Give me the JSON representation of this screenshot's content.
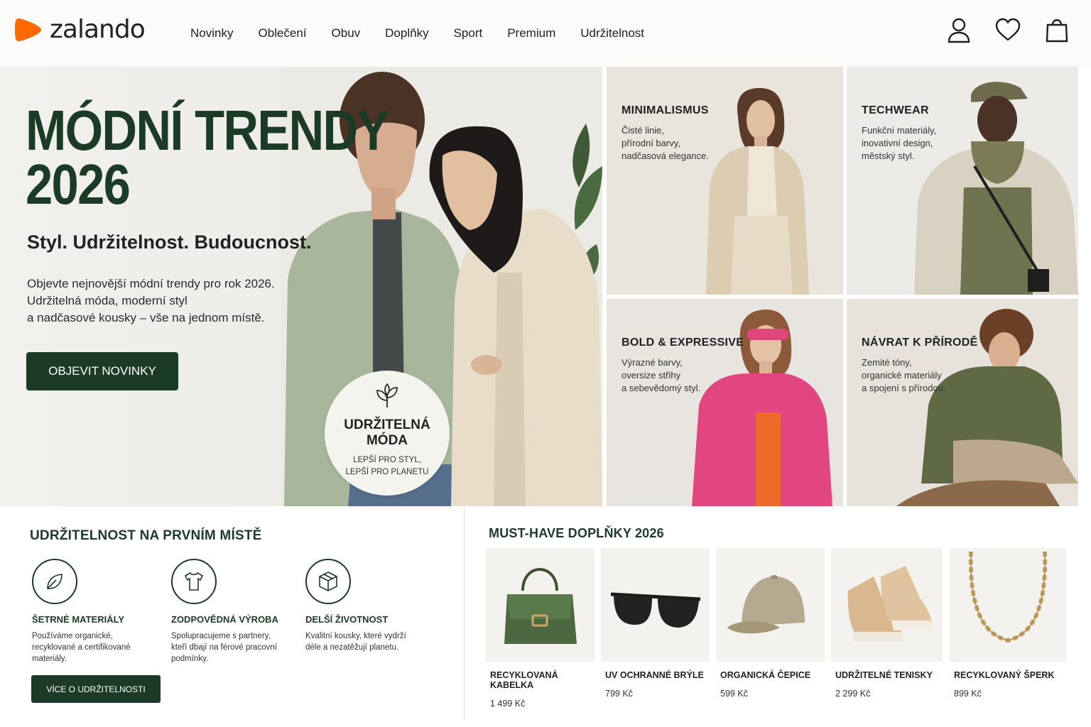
{
  "header": {
    "logo_text": "zalando",
    "brand_color": "#FF6900",
    "nav": [
      "Novinky",
      "Oblečení",
      "Obuv",
      "Doplňky",
      "Sport",
      "Premium",
      "Udržitelnost"
    ],
    "icons": [
      "user-icon",
      "heart-icon",
      "bag-icon"
    ]
  },
  "hero": {
    "title_line1": "MÓDNÍ TRENDY",
    "title_line2": "2026",
    "subtitle": "Styl. Udržitelnost. Budoucnost.",
    "description": [
      "Objevte nejnovější módní trendy pro rok 2026.",
      "Udržitelná móda, moderní styl",
      "a nadčasové kousky – vše na jednom místě."
    ],
    "cta": "OBJEVIT NOVINKY",
    "badge": {
      "title_line1": "UDRŽITELNÁ",
      "title_line2": "MÓDA",
      "sub_line1": "LEPŠÍ PRO STYL,",
      "sub_line2": "LEPŠÍ PRO PLANETU"
    }
  },
  "trends": [
    {
      "title": "MINIMALISMUS",
      "desc": [
        "Čisté linie,",
        "přírodní barvy,",
        "nadčasová elegance."
      ]
    },
    {
      "title": "TECHWEAR",
      "desc": [
        "Funkční materiály,",
        "inovativní design,",
        "městský styl."
      ]
    },
    {
      "title": "BOLD & EXPRESSIVE",
      "desc": [
        "Výrazné barvy,",
        "oversize střihy",
        "a sebevědomý styl."
      ]
    },
    {
      "title": "NÁVRAT K PŘÍRODĚ",
      "desc": [
        "Zemité tóny,",
        "organické materiály",
        "a spojení s přírodou."
      ]
    }
  ],
  "sustainability": {
    "title": "UDRŽITELNOST NA PRVNÍM MÍSTĚ",
    "features": [
      {
        "icon": "leaf-icon",
        "title": "ŠETRNÉ MATERIÁLY",
        "desc": [
          "Používáme organické,",
          "recyklované a certifikované",
          "materiály."
        ]
      },
      {
        "icon": "tshirt-icon",
        "title": "ZODPOVĚDNÁ VÝROBA",
        "desc": [
          "Spolupracujeme s partnery,",
          "kteří dbají na férové pracovní",
          "podmínky."
        ]
      },
      {
        "icon": "box-icon",
        "title": "DELŠÍ ŽIVOTNOST",
        "desc": [
          "Kvalitní kousky, které vydrží",
          "déle a nezatěžují planetu."
        ]
      }
    ],
    "button": "VÍCE O UDRŽITELNOSTI"
  },
  "accessories": {
    "title": "MUST-HAVE DOPLŇKY 2026",
    "products": [
      {
        "name": "RECYKLOVANÁ KABELKA",
        "price": "1 499 Kč",
        "icon": "handbag-icon"
      },
      {
        "name": "UV OCHRANNÉ BRÝLE",
        "price": "799 Kč",
        "icon": "sunglasses-icon"
      },
      {
        "name": "ORGANICKÁ ČEPICE",
        "price": "599 Kč",
        "icon": "cap-icon"
      },
      {
        "name": "UDRŽITELNÉ TENISKY",
        "price": "2 299 Kč",
        "icon": "sneakers-icon"
      },
      {
        "name": "RECYKLOVANÝ ŠPERK",
        "price": "899 Kč",
        "icon": "necklace-icon"
      }
    ]
  },
  "colors": {
    "primary_green": "#1C3B27",
    "background": "#FFFFFF",
    "badge_bg": "#F3F4EE"
  }
}
